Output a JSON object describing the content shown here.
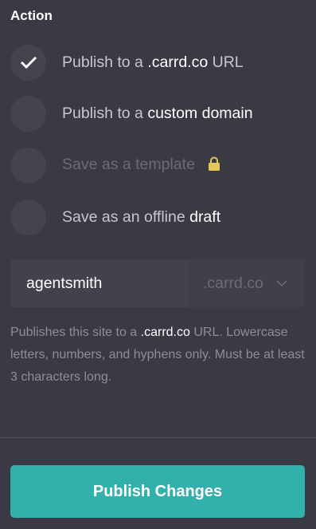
{
  "section": {
    "title": "Action"
  },
  "options": [
    {
      "prefix": "Publish to a ",
      "highlight": ".carrd.co",
      "suffix": " URL",
      "selected": true,
      "disabled": false
    },
    {
      "prefix": "Publish to a ",
      "highlight": "custom domain",
      "suffix": "",
      "selected": false,
      "disabled": false
    },
    {
      "prefix": "Save as a template",
      "highlight": "",
      "suffix": "",
      "selected": false,
      "disabled": true,
      "icon": "lock-icon"
    },
    {
      "prefix": "Save as an offline ",
      "highlight": "draft",
      "suffix": "",
      "selected": false,
      "disabled": false
    }
  ],
  "domain": {
    "value": "agentsmith",
    "suffix_selected": ".carrd.co"
  },
  "help": {
    "before": "Publishes this site to a ",
    "highlight": ".carrd.co",
    "after": " URL. Lowercase letters, numbers, and hyphens only. Must be at least 3 characters long."
  },
  "actions": {
    "publish_label": "Publish Changes"
  },
  "colors": {
    "background": "#3a3a45",
    "accent": "#32b0ab",
    "lock": "#e6c55a"
  }
}
